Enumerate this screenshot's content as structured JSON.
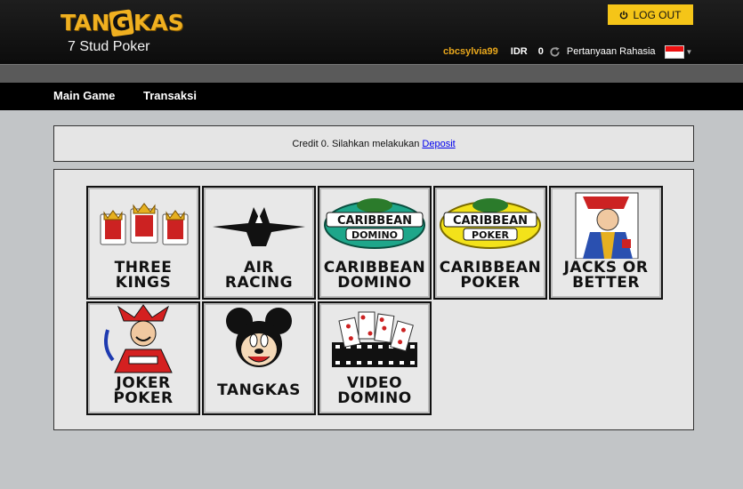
{
  "brand": {
    "logo_pre": "TAN",
    "logo_k": "G",
    "logo_post": "KAS",
    "subtitle": "7 Stud Poker"
  },
  "header": {
    "logout_label": "LOG OUT",
    "username": "cbcsylvia99",
    "currency": "IDR",
    "balance": "0",
    "secret_question": "Pertanyaan Rahasia"
  },
  "nav": {
    "items": [
      {
        "label": "Main Game"
      },
      {
        "label": "Transaksi"
      }
    ]
  },
  "credit": {
    "message": "Credit 0. Silahkan melakukan",
    "deposit_link": "Deposit"
  },
  "games": [
    {
      "line1": "THREE",
      "line2": "KINGS",
      "icon": "three-kings-cards-icon"
    },
    {
      "line1": "AIR",
      "line2": "RACING",
      "icon": "fighter-jet-icon"
    },
    {
      "line1": "CARIBBEAN",
      "line2": "DOMINO",
      "icon": "caribbean-domino-logo-icon",
      "badge1": "CARIBBEAN",
      "badge2": "DOMINO"
    },
    {
      "line1": "CARIBBEAN",
      "line2": "POKER",
      "icon": "caribbean-poker-logo-icon",
      "badge1": "CARIBBEAN",
      "badge2": "POKER"
    },
    {
      "line1": "JACKS OR",
      "line2": "BETTER",
      "icon": "jack-card-icon"
    },
    {
      "line1": "JOKER",
      "line2": "POKER",
      "icon": "joker-icon"
    },
    {
      "line1": "TANGKAS",
      "line2": "",
      "icon": "mickey-mouse-icon"
    },
    {
      "line1": "VIDEO",
      "line2": "DOMINO",
      "icon": "domino-film-icon"
    }
  ],
  "colors": {
    "accent": "#f5c518",
    "username": "#e8a71c",
    "nav_bg": "#000000",
    "page_bg": "#c2c5c7"
  }
}
